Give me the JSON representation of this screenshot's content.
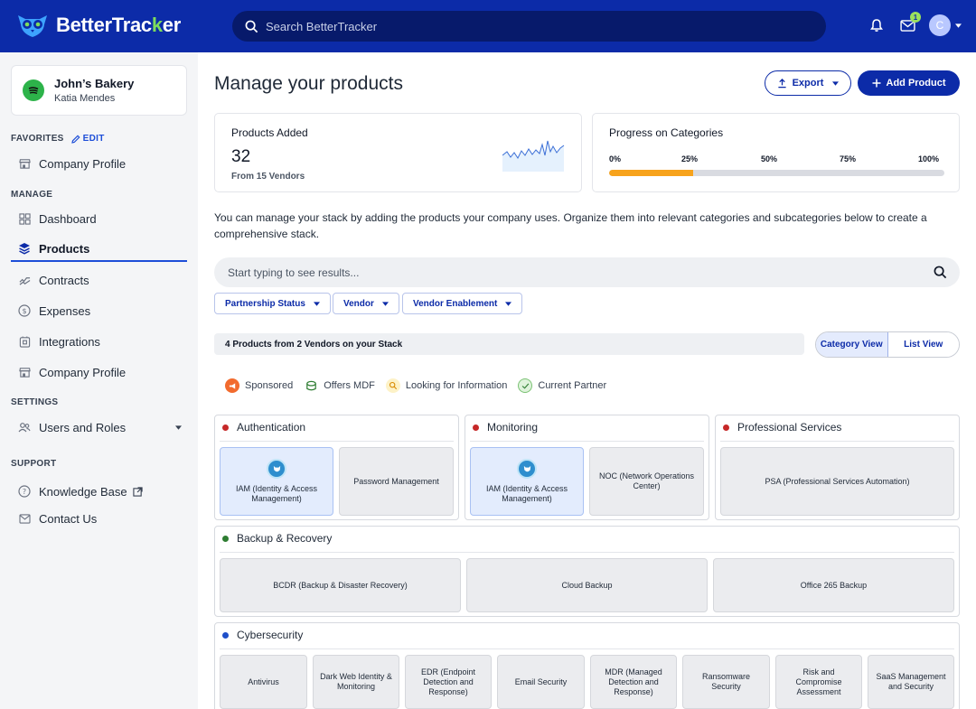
{
  "app": {
    "brand_part1": "Better",
    "brand_part2": "Trac",
    "brand_part3": "k",
    "brand_part4": "er",
    "search_placeholder": "Search BetterTracker",
    "mail_badge": "1",
    "avatar_initial": "C"
  },
  "sidebar": {
    "company_name": "John’s Bakery",
    "company_user": "Katia Mendes",
    "favorites_label": "FAVORITES",
    "edit_label": "EDIT",
    "favorites": [
      {
        "label": "Company Profile",
        "icon": "store-icon"
      }
    ],
    "manage_label": "MANAGE",
    "manage": [
      {
        "label": "Dashboard",
        "icon": "grid-icon"
      },
      {
        "label": "Products",
        "icon": "layers-icon",
        "active": true
      },
      {
        "label": "Contracts",
        "icon": "handshake-icon"
      },
      {
        "label": "Expenses",
        "icon": "dollar-icon"
      },
      {
        "label": "Integrations",
        "icon": "integrations-icon"
      },
      {
        "label": "Company Profile",
        "icon": "store-icon"
      }
    ],
    "settings_label": "SETTINGS",
    "settings": [
      {
        "label": "Users and Roles",
        "icon": "users-icon"
      }
    ],
    "support_label": "SUPPORT",
    "support": [
      {
        "label": "Knowledge Base",
        "icon": "question-icon"
      },
      {
        "label": "Contact Us",
        "icon": "mail-icon"
      }
    ]
  },
  "main": {
    "title": "Manage your products",
    "export_label": "Export",
    "add_label": "Add Product",
    "products_card": {
      "title": "Products Added",
      "count": "32",
      "sub": "From 15 Vendors"
    },
    "progress_card": {
      "title": "Progress on Categories",
      "ticks": [
        "0%",
        "25%",
        "50%",
        "75%",
        "100%"
      ],
      "fill_fraction": 0.25
    },
    "description": "You can manage your stack by adding the products your company uses. Organize them into relevant categories and subcategories below to create a comprehensive stack.",
    "search_placeholder": "Start typing to see results...",
    "filters": [
      "Partnership Status",
      "Vendor",
      "Vendor Enablement"
    ],
    "summary": "4 Products from 2 Vendors on your Stack",
    "view_category": "Category View",
    "view_list": "List View",
    "legend": [
      "Sponsored",
      "Offers MDF",
      "Looking for Information",
      "Current Partner"
    ],
    "categories": {
      "authentication": {
        "name": "Authentication",
        "color": "#c62828",
        "tiles": [
          "IAM (Identity & Access Management)",
          "Password Management"
        ]
      },
      "monitoring": {
        "name": "Monitoring",
        "color": "#c62828",
        "tiles": [
          "IAM (Identity & Access Management)",
          "NOC (Network Operations Center)"
        ]
      },
      "professional": {
        "name": "Professional Services",
        "color": "#c62828",
        "tiles": [
          "PSA (Professional Services Automation)"
        ]
      },
      "backup": {
        "name": "Backup & Recovery",
        "color": "#2e7d32",
        "tiles": [
          "BCDR (Backup & Disaster Recovery)",
          "Cloud Backup",
          "Office 265 Backup"
        ]
      },
      "cyber": {
        "name": "Cybersecurity",
        "color": "#1e4fc9",
        "tiles": [
          "Antivirus",
          "Dark Web Identity & Monitoring",
          "EDR (Endpoint Detection and Response)",
          "Email Security",
          "MDR (Managed Detection and Response)",
          "Ransomware Security",
          "Risk and Compromise Assessment",
          "SaaS Management and Security"
        ]
      }
    }
  },
  "colors": {
    "brand": "#0c2ba8",
    "accent_green": "#7ddc5c",
    "progress": "#f7a31c"
  }
}
